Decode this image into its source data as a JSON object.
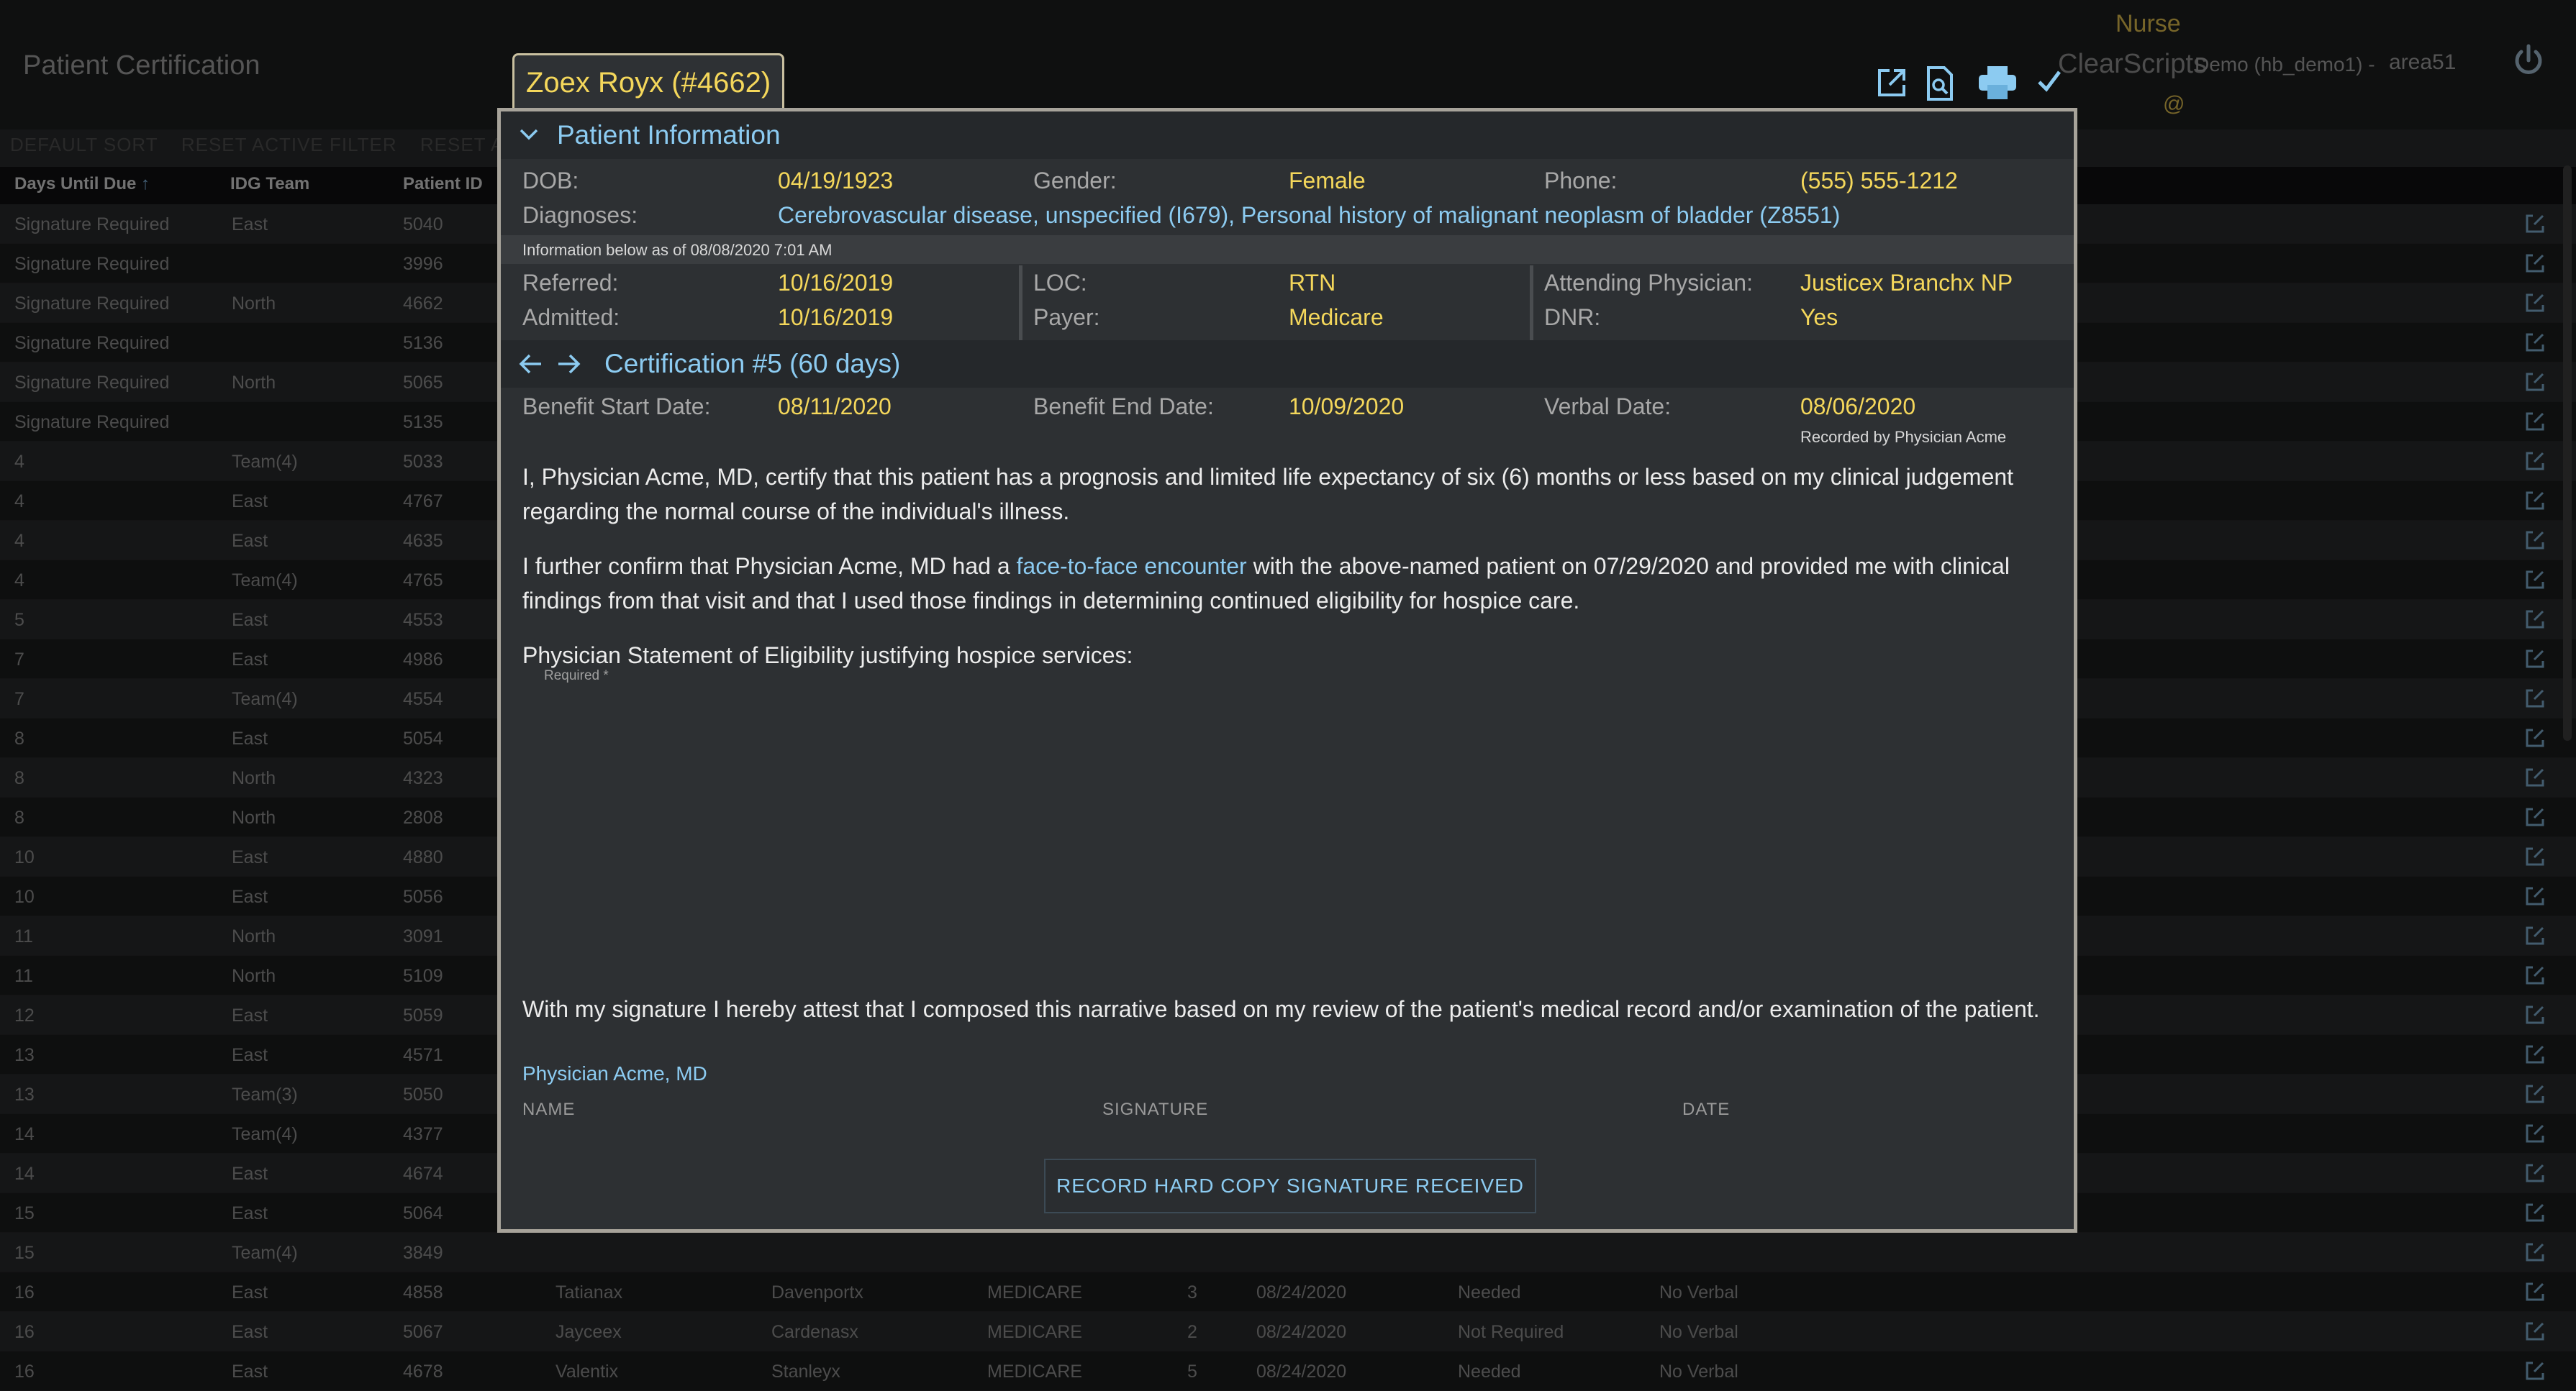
{
  "app": {
    "title": "Patient Certification",
    "toolbar": [
      "DEFAULT SORT",
      "RESET ACTIVE FILTER",
      "RESET ALL"
    ],
    "user_role": "Nurse",
    "product": "ClearScripts",
    "demo_name": "Demo (hb_demo1) -",
    "user_code": "area51",
    "user_at": "@"
  },
  "grid": {
    "columns": [
      "Days Until Due",
      "IDG Team",
      "Patient ID"
    ],
    "sort_indicator": "↑",
    "rows": [
      {
        "days": "Signature Required",
        "team": "East",
        "id": "5040"
      },
      {
        "days": "Signature Required",
        "team": "",
        "id": "3996"
      },
      {
        "days": "Signature Required",
        "team": "North",
        "id": "4662"
      },
      {
        "days": "Signature Required",
        "team": "",
        "id": "5136"
      },
      {
        "days": "Signature Required",
        "team": "North",
        "id": "5065"
      },
      {
        "days": "Signature Required",
        "team": "",
        "id": "5135"
      },
      {
        "days": "4",
        "team": "Team(4)",
        "id": "5033"
      },
      {
        "days": "4",
        "team": "East",
        "id": "4767"
      },
      {
        "days": "4",
        "team": "East",
        "id": "4635"
      },
      {
        "days": "4",
        "team": "Team(4)",
        "id": "4765"
      },
      {
        "days": "5",
        "team": "East",
        "id": "4553"
      },
      {
        "days": "7",
        "team": "East",
        "id": "4986"
      },
      {
        "days": "7",
        "team": "Team(4)",
        "id": "4554"
      },
      {
        "days": "8",
        "team": "East",
        "id": "5054"
      },
      {
        "days": "8",
        "team": "North",
        "id": "4323"
      },
      {
        "days": "8",
        "team": "North",
        "id": "2808"
      },
      {
        "days": "10",
        "team": "East",
        "id": "4880"
      },
      {
        "days": "10",
        "team": "East",
        "id": "5056"
      },
      {
        "days": "11",
        "team": "North",
        "id": "3091"
      },
      {
        "days": "11",
        "team": "North",
        "id": "5109"
      },
      {
        "days": "12",
        "team": "East",
        "id": "5059"
      },
      {
        "days": "13",
        "team": "East",
        "id": "4571"
      },
      {
        "days": "13",
        "team": "Team(3)",
        "id": "5050"
      },
      {
        "days": "14",
        "team": "Team(4)",
        "id": "4377"
      },
      {
        "days": "14",
        "team": "East",
        "id": "4674"
      },
      {
        "days": "15",
        "team": "East",
        "id": "5064"
      },
      {
        "days": "15",
        "team": "Team(4)",
        "id": "3849"
      },
      {
        "days": "16",
        "team": "East",
        "id": "4858",
        "first": "Tatianax",
        "last": "Davenportx",
        "payer": "MEDICARE",
        "n": "3",
        "date": "08/24/2020",
        "status": "Needed",
        "verbal": "No Verbal"
      },
      {
        "days": "16",
        "team": "East",
        "id": "5067",
        "first": "Jayceex",
        "last": "Cardenasx",
        "payer": "MEDICARE",
        "n": "2",
        "date": "08/24/2020",
        "status": "Not Required",
        "verbal": "No Verbal"
      },
      {
        "days": "16",
        "team": "East",
        "id": "4678",
        "first": "Valentix",
        "last": "Stanleyx",
        "payer": "MEDICARE",
        "n": "5",
        "date": "08/24/2020",
        "status": "Needed",
        "verbal": "No Verbal"
      }
    ]
  },
  "modal": {
    "title": "Zoex Royx (#4662)",
    "icons": [
      "open-external-icon",
      "document-search-icon",
      "print-icon",
      "check-icon"
    ],
    "patient_info": {
      "header": "Patient Information",
      "dob_label": "DOB:",
      "dob": "04/19/1923",
      "gender_label": "Gender:",
      "gender": "Female",
      "phone_label": "Phone:",
      "phone": "(555) 555-1212",
      "diagnoses_label": "Diagnoses:",
      "diagnoses": "Cerebrovascular disease, unspecified (I679), Personal history of malignant neoplasm of bladder (Z8551)",
      "as_of": "Information below as of 08/08/2020 7:01 AM",
      "referred_label": "Referred:",
      "referred": "10/16/2019",
      "admitted_label": "Admitted:",
      "admitted": "10/16/2019",
      "loc_label": "LOC:",
      "loc": "RTN",
      "payer_label": "Payer:",
      "payer": "Medicare",
      "attending_label": "Attending Physician:",
      "attending": "Justicex Branchx NP",
      "dnr_label": "DNR:",
      "dnr": "Yes"
    },
    "certification": {
      "header": "Certification #5 (60 days)",
      "benefit_start_label": "Benefit Start Date:",
      "benefit_start": "08/11/2020",
      "benefit_end_label": "Benefit End Date:",
      "benefit_end": "10/09/2020",
      "verbal_label": "Verbal Date:",
      "verbal": "08/06/2020",
      "recorded_by": "Recorded by Physician Acme",
      "para1": "I, Physician Acme, MD, certify that this patient has a prognosis and limited life expectancy of six (6) months or less based on my clinical judgement regarding the normal course of the individual's illness.",
      "para2_a": "I further confirm that Physician Acme, MD had a ",
      "para2_link": "face-to-face encounter",
      "para2_b": " with the above-named patient on 07/29/2020 and provided me with clinical findings from that visit and that I used those findings in determining continued eligibility for hospice care.",
      "statement_label": "Physician Statement of Eligibility justifying hospice services:",
      "required": "Required *",
      "attest": "With my signature I hereby attest that I composed this narrative based on my review of the patient's medical record and/or examination of the patient.",
      "physician": "Physician Acme, MD",
      "name_label": "NAME",
      "signature_label": "SIGNATURE",
      "date_label": "DATE",
      "record_button": "RECORD HARD COPY SIGNATURE RECEIVED"
    }
  }
}
